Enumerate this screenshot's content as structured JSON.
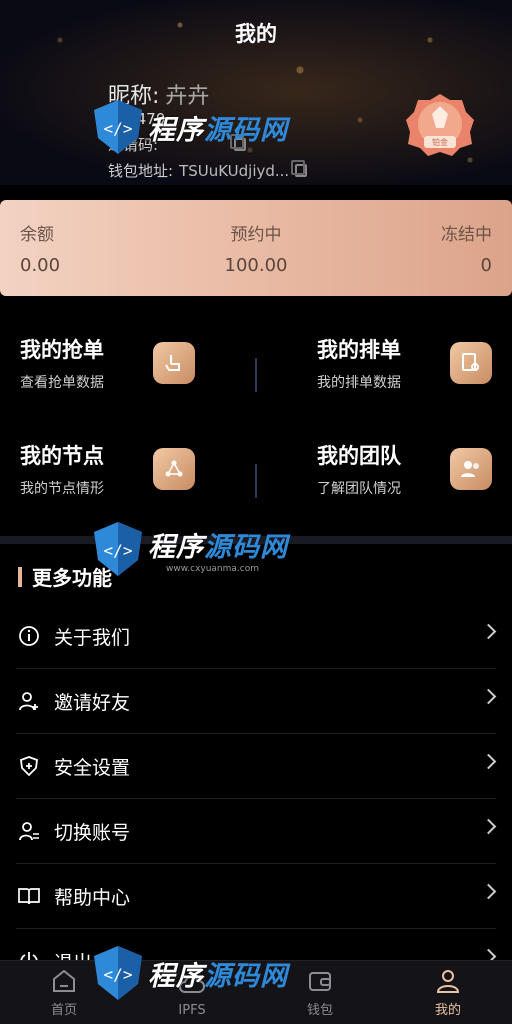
{
  "header": {
    "title": "我的",
    "nickname_label": "昵称:",
    "nickname": "卉卉",
    "uid": "135470",
    "invite_label": "邀请码:",
    "wallet_label": "钱包地址:",
    "wallet_address": "TSUuKUdjiyd...",
    "medal_label": "铂金"
  },
  "balance": {
    "available_label": "余额",
    "available_value": "0.00",
    "reserved_label": "预约中",
    "reserved_value": "100.00",
    "frozen_label": "冻结中",
    "frozen_value": "0"
  },
  "grid": [
    {
      "title": "我的抢单",
      "sub": "查看抢单数据"
    },
    {
      "title": "我的排单",
      "sub": "我的排单数据"
    },
    {
      "title": "我的节点",
      "sub": "我的节点情形"
    },
    {
      "title": "我的团队",
      "sub": "了解团队情况"
    }
  ],
  "more": {
    "title": "更多功能",
    "items": [
      {
        "label": "关于我们",
        "icon": "info-icon"
      },
      {
        "label": "邀请好友",
        "icon": "user-plus-icon"
      },
      {
        "label": "安全设置",
        "icon": "shield-icon"
      },
      {
        "label": "切换账号",
        "icon": "switch-user-icon"
      },
      {
        "label": "帮助中心",
        "icon": "book-icon"
      },
      {
        "label": "退出",
        "icon": "logout-icon"
      }
    ]
  },
  "tabbar": {
    "items": [
      {
        "label": "首页",
        "icon": "home-icon"
      },
      {
        "label": "IPFS",
        "icon": "cloud-icon"
      },
      {
        "label": "钱包",
        "icon": "wallet-icon"
      },
      {
        "label": "我的",
        "icon": "profile-icon"
      }
    ],
    "active_index": 3
  },
  "watermark": {
    "text_a": "程序",
    "text_b": "源码网",
    "url": "www.cxyuanma.com"
  },
  "colors": {
    "accent": "#e9c3a2",
    "card": "#e8b8a1",
    "bg": "#000000"
  }
}
